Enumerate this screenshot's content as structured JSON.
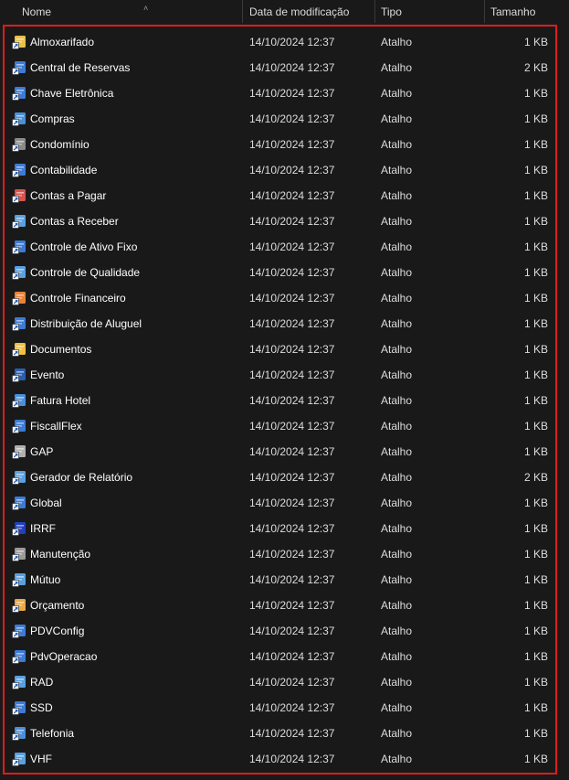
{
  "columns": {
    "name": "Nome",
    "date": "Data de modificação",
    "type": "Tipo",
    "size": "Tamanho"
  },
  "colors": {
    "background": "#191919",
    "selection_border": "#e01b1b",
    "text": "#ffffff"
  },
  "files": [
    {
      "name": "Almoxarifado",
      "date": "14/10/2024 12:37",
      "type": "Atalho",
      "size": "1 KB",
      "icon": "warehouse-icon",
      "color": "#e8c14a"
    },
    {
      "name": "Central de Reservas",
      "date": "14/10/2024 12:37",
      "type": "Atalho",
      "size": "2 KB",
      "icon": "building-icon",
      "color": "#3d7bd6"
    },
    {
      "name": "Chave Eletrônica",
      "date": "14/10/2024 12:37",
      "type": "Atalho",
      "size": "1 KB",
      "icon": "key-card-icon",
      "color": "#3d7bd6"
    },
    {
      "name": "Compras",
      "date": "14/10/2024 12:37",
      "type": "Atalho",
      "size": "1 KB",
      "icon": "shopping-cart-icon",
      "color": "#4a90d9"
    },
    {
      "name": "Condomínio",
      "date": "14/10/2024 12:37",
      "type": "Atalho",
      "size": "1 KB",
      "icon": "house-icon",
      "color": "#8a8a8a"
    },
    {
      "name": "Contabilidade",
      "date": "14/10/2024 12:37",
      "type": "Atalho",
      "size": "1 KB",
      "icon": "calculator-icon",
      "color": "#3d7bd6"
    },
    {
      "name": "Contas a Pagar",
      "date": "14/10/2024 12:37",
      "type": "Atalho",
      "size": "1 KB",
      "icon": "bill-pay-icon",
      "color": "#d9534f"
    },
    {
      "name": "Contas a Receber",
      "date": "14/10/2024 12:37",
      "type": "Atalho",
      "size": "1 KB",
      "icon": "bill-receive-icon",
      "color": "#5aa0e0"
    },
    {
      "name": "Controle de Ativo Fixo",
      "date": "14/10/2024 12:37",
      "type": "Atalho",
      "size": "1 KB",
      "icon": "chart-icon",
      "color": "#3d7bd6"
    },
    {
      "name": "Controle de Qualidade",
      "date": "14/10/2024 12:37",
      "type": "Atalho",
      "size": "1 KB",
      "icon": "thumbs-up-icon",
      "color": "#5aa0e0"
    },
    {
      "name": "Controle Financeiro",
      "date": "14/10/2024 12:37",
      "type": "Atalho",
      "size": "1 KB",
      "icon": "finance-icon",
      "color": "#e8843a"
    },
    {
      "name": "Distribuição de Aluguel",
      "date": "14/10/2024 12:37",
      "type": "Atalho",
      "size": "1 KB",
      "icon": "line-chart-icon",
      "color": "#3d7bd6"
    },
    {
      "name": "Documentos",
      "date": "14/10/2024 12:37",
      "type": "Atalho",
      "size": "1 KB",
      "icon": "folder-icon",
      "color": "#f0c040"
    },
    {
      "name": "Evento",
      "date": "14/10/2024 12:37",
      "type": "Atalho",
      "size": "1 KB",
      "icon": "event-icon",
      "color": "#2a5fb0"
    },
    {
      "name": "Fatura Hotel",
      "date": "14/10/2024 12:37",
      "type": "Atalho",
      "size": "1 KB",
      "icon": "hotel-icon",
      "color": "#4a90d9"
    },
    {
      "name": "FiscallFlex",
      "date": "14/10/2024 12:37",
      "type": "Atalho",
      "size": "1 KB",
      "icon": "fiscal-icon",
      "color": "#3d7bd6"
    },
    {
      "name": "GAP",
      "date": "14/10/2024 12:37",
      "type": "Atalho",
      "size": "1 KB",
      "icon": "person-icon",
      "color": "#b0b0b0"
    },
    {
      "name": "Gerador de Relatório",
      "date": "14/10/2024 12:37",
      "type": "Atalho",
      "size": "2 KB",
      "icon": "report-icon",
      "color": "#5aa0e0"
    },
    {
      "name": "Global",
      "date": "14/10/2024 12:37",
      "type": "Atalho",
      "size": "1 KB",
      "icon": "globe-icon",
      "color": "#3d7bd6"
    },
    {
      "name": "IRRF",
      "date": "14/10/2024 12:37",
      "type": "Atalho",
      "size": "1 KB",
      "icon": "tax-icon",
      "color": "#2040c0"
    },
    {
      "name": "Manutenção",
      "date": "14/10/2024 12:37",
      "type": "Atalho",
      "size": "1 KB",
      "icon": "tools-icon",
      "color": "#9a9a9a"
    },
    {
      "name": "Mútuo",
      "date": "14/10/2024 12:37",
      "type": "Atalho",
      "size": "1 KB",
      "icon": "handshake-icon",
      "color": "#5aa0e0"
    },
    {
      "name": "Orçamento",
      "date": "14/10/2024 12:37",
      "type": "Atalho",
      "size": "1 KB",
      "icon": "budget-icon",
      "color": "#e8a84a"
    },
    {
      "name": "PDVConfig",
      "date": "14/10/2024 12:37",
      "type": "Atalho",
      "size": "1 KB",
      "icon": "pos-config-icon",
      "color": "#3d7bd6"
    },
    {
      "name": "PdvOperacao",
      "date": "14/10/2024 12:37",
      "type": "Atalho",
      "size": "1 KB",
      "icon": "pos-operation-icon",
      "color": "#3d7bd6"
    },
    {
      "name": "RAD",
      "date": "14/10/2024 12:37",
      "type": "Atalho",
      "size": "1 KB",
      "icon": "document-icon",
      "color": "#5aa0e0"
    },
    {
      "name": "SSD",
      "date": "14/10/2024 12:37",
      "type": "Atalho",
      "size": "1 KB",
      "icon": "ssd-icon",
      "color": "#3d7bd6"
    },
    {
      "name": "Telefonia",
      "date": "14/10/2024 12:37",
      "type": "Atalho",
      "size": "1 KB",
      "icon": "phone-icon",
      "color": "#4a90d9"
    },
    {
      "name": "VHF",
      "date": "14/10/2024 12:37",
      "type": "Atalho",
      "size": "1 KB",
      "icon": "radio-icon",
      "color": "#5aa0e0"
    }
  ]
}
